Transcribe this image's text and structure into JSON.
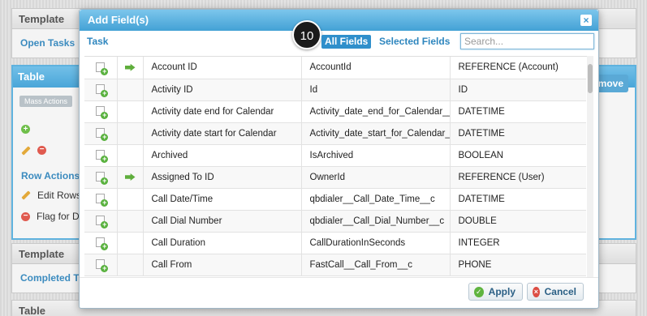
{
  "background": {
    "panels": [
      {
        "title": "Template",
        "link": "Open Tasks"
      },
      {
        "title": "Template",
        "link": "Completed Ta"
      },
      {
        "title": "Table",
        "link": ""
      }
    ],
    "table_panel": {
      "title": "Table",
      "mass_actions": "Mass Actions",
      "remove_label": "emove",
      "row_actions": "Row Actions",
      "items": [
        "Edit Rows",
        "Flag for D"
      ]
    }
  },
  "modal": {
    "title": "Add Field(s)",
    "close": "×",
    "object_label": "Task",
    "step_badge": "10",
    "tabs": {
      "all": "All Fields",
      "selected": "Selected Fields"
    },
    "search": {
      "placeholder": "Search...",
      "value": ""
    },
    "fields": [
      {
        "label": "Account ID",
        "api": "AccountId",
        "type": "REFERENCE (Account)",
        "ref": true
      },
      {
        "label": "Activity ID",
        "api": "Id",
        "type": "ID",
        "ref": false
      },
      {
        "label": "Activity date end for Calendar",
        "api": "Activity_date_end_for_Calendar__c",
        "type": "DATETIME",
        "ref": false
      },
      {
        "label": "Activity date start for Calendar",
        "api": "Activity_date_start_for_Calendar__c",
        "type": "DATETIME",
        "ref": false
      },
      {
        "label": "Archived",
        "api": "IsArchived",
        "type": "BOOLEAN",
        "ref": false
      },
      {
        "label": "Assigned To ID",
        "api": "OwnerId",
        "type": "REFERENCE (User)",
        "ref": true
      },
      {
        "label": "Call Date/Time",
        "api": "qbdialer__Call_Date_Time__c",
        "type": "DATETIME",
        "ref": false
      },
      {
        "label": "Call Dial Number",
        "api": "qbdialer__Call_Dial_Number__c",
        "type": "DOUBLE",
        "ref": false
      },
      {
        "label": "Call Duration",
        "api": "CallDurationInSeconds",
        "type": "INTEGER",
        "ref": false
      },
      {
        "label": "Call From",
        "api": "FastCall__Call_From__c",
        "type": "PHONE",
        "ref": false
      }
    ],
    "buttons": {
      "apply": "Apply",
      "cancel": "Cancel"
    }
  },
  "colors": {
    "accent": "#43a1d5",
    "link": "#2e86be",
    "add_green": "#58b13d",
    "cancel_red": "#dc4d43"
  }
}
